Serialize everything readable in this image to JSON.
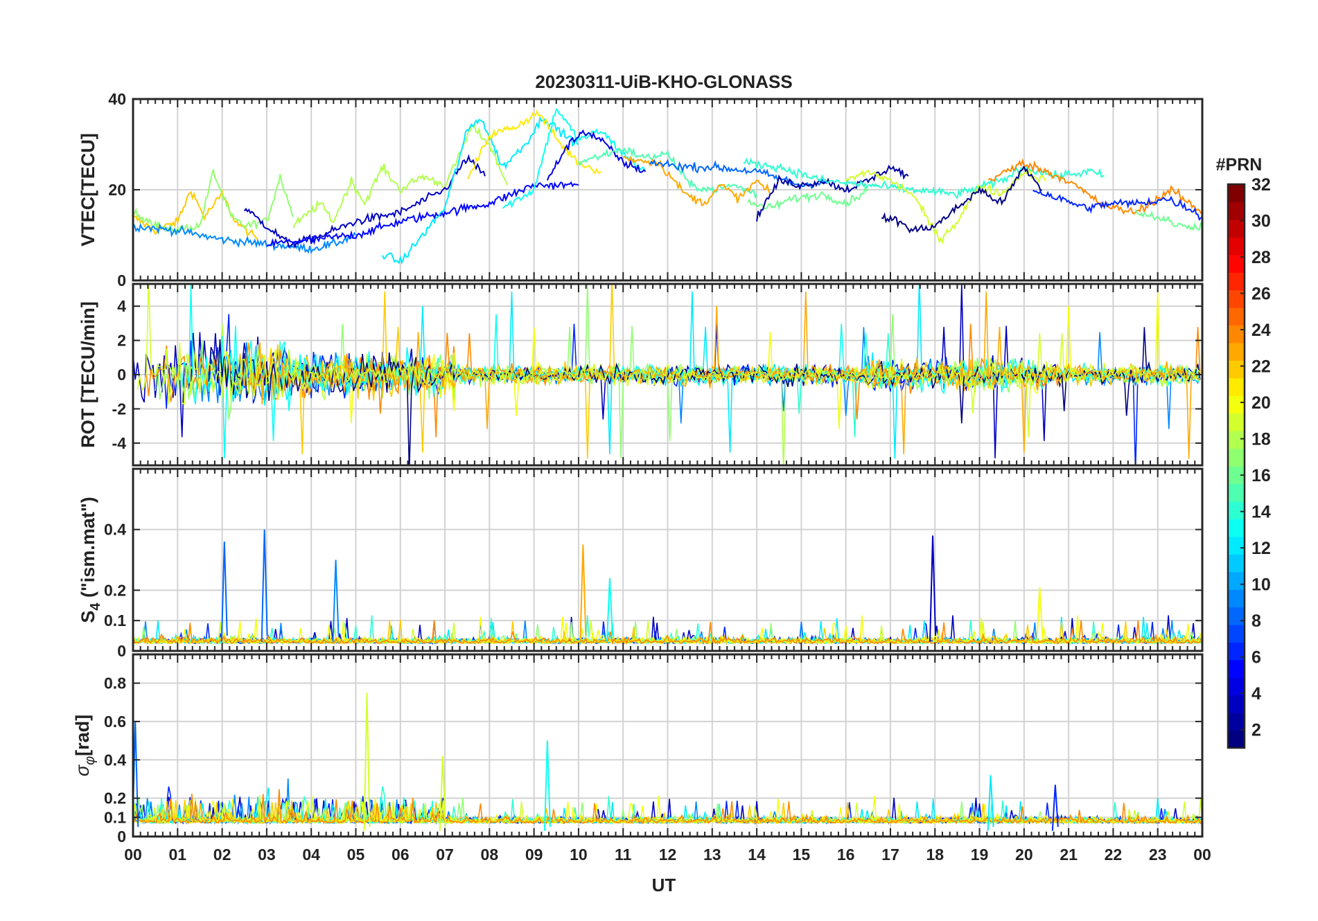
{
  "chart_data": {
    "type": "line",
    "title": "20230311-UiB-KHO-GLONASS",
    "xlabel": "UT",
    "x_unit": "hour (UT)",
    "x_ticks": [
      "00",
      "01",
      "02",
      "03",
      "04",
      "05",
      "06",
      "07",
      "08",
      "09",
      "10",
      "11",
      "12",
      "13",
      "14",
      "15",
      "16",
      "17",
      "18",
      "19",
      "20",
      "21",
      "22",
      "23",
      "00"
    ],
    "grid": true,
    "colorbar": {
      "title": "#PRN",
      "range": [
        1,
        32
      ],
      "ticks": [
        "2",
        "4",
        "6",
        "8",
        "10",
        "12",
        "14",
        "16",
        "18",
        "20",
        "22",
        "24",
        "26",
        "28",
        "30",
        "32"
      ],
      "colormap": "jet",
      "placement": "right"
    },
    "panels": [
      {
        "name": "vtec",
        "ylabel": "VTEC[TECU]",
        "ylim": [
          0,
          40
        ],
        "yticks": [
          "0",
          "20",
          "40"
        ],
        "series": [
          {
            "prn": 22,
            "points": [
              [
                0,
                14
              ],
              [
                0.5,
                11
              ],
              [
                1,
                13
              ],
              [
                1.3,
                20
              ],
              [
                1.6,
                14
              ],
              [
                2,
                19
              ],
              [
                2.3,
                13
              ],
              [
                2.8,
                9
              ]
            ]
          },
          {
            "prn": 17,
            "points": [
              [
                0,
                15
              ],
              [
                0.8,
                11
              ],
              [
                1.5,
                12
              ],
              [
                1.8,
                24
              ],
              [
                2.2,
                14
              ],
              [
                2.5,
                12
              ],
              [
                3,
                13
              ],
              [
                3.3,
                23
              ],
              [
                3.6,
                14
              ]
            ]
          },
          {
            "prn": 9,
            "points": [
              [
                0,
                12
              ],
              [
                1,
                11
              ],
              [
                2,
                9
              ],
              [
                3,
                8
              ],
              [
                4,
                7
              ],
              [
                4.5,
                8
              ],
              [
                5,
                10
              ]
            ]
          },
          {
            "prn": 18,
            "points": [
              [
                3.6,
                12
              ],
              [
                4.2,
                17
              ],
              [
                4.5,
                13
              ],
              [
                4.9,
                22
              ],
              [
                5.2,
                17
              ],
              [
                5.6,
                25
              ],
              [
                6,
                20
              ],
              [
                6.5,
                23
              ],
              [
                7,
                21
              ],
              [
                7.3,
                27
              ],
              [
                7.6,
                34
              ],
              [
                8,
                30
              ],
              [
                8.4,
                21
              ]
            ]
          },
          {
            "prn": 3,
            "points": [
              [
                2.5,
                16
              ],
              [
                3.5,
                8
              ],
              [
                4,
                9
              ],
              [
                5,
                13
              ],
              [
                6,
                15
              ],
              [
                7,
                20
              ],
              [
                7.5,
                27
              ],
              [
                7.9,
                23
              ]
            ]
          },
          {
            "prn": 5,
            "points": [
              [
                3,
                8
              ],
              [
                4,
                9
              ],
              [
                5,
                10
              ],
              [
                6,
                13
              ],
              [
                7,
                15
              ],
              [
                8,
                17
              ],
              [
                9,
                21
              ],
              [
                10,
                21
              ]
            ]
          },
          {
            "prn": 12,
            "points": [
              [
                5.6,
                6
              ],
              [
                6,
                4
              ],
              [
                6.5,
                10
              ],
              [
                7,
                16
              ],
              [
                7.5,
                33
              ],
              [
                7.8,
                36
              ],
              [
                8.3,
                25
              ],
              [
                8.8,
                30
              ],
              [
                9.2,
                36
              ],
              [
                9.7,
                32
              ],
              [
                10,
                30
              ]
            ]
          },
          {
            "prn": 21,
            "points": [
              [
                7.5,
                22
              ],
              [
                8,
                32
              ],
              [
                8.6,
                34
              ],
              [
                9.1,
                37
              ],
              [
                9.6,
                30
              ],
              [
                10,
                26
              ],
              [
                10.5,
                24
              ]
            ]
          },
          {
            "prn": 13,
            "points": [
              [
                8.3,
                16
              ],
              [
                9,
                20
              ],
              [
                9.5,
                38
              ],
              [
                10,
                31
              ],
              [
                10.5,
                33
              ],
              [
                11,
                28
              ],
              [
                11.5,
                24
              ]
            ]
          },
          {
            "prn": 4,
            "points": [
              [
                9.3,
                22
              ],
              [
                9.7,
                29
              ],
              [
                10.1,
                33
              ],
              [
                10.5,
                31
              ],
              [
                11,
                26
              ],
              [
                11.5,
                24
              ]
            ]
          },
          {
            "prn": 15,
            "points": [
              [
                10,
                26
              ],
              [
                11,
                29
              ],
              [
                11.5,
                27
              ],
              [
                12,
                28
              ],
              [
                12.5,
                21
              ],
              [
                13,
                20
              ],
              [
                13.5,
                21
              ],
              [
                14,
                19
              ]
            ]
          },
          {
            "prn": 23,
            "points": [
              [
                11,
                27
              ],
              [
                11.8,
                26
              ],
              [
                12.4,
                19
              ],
              [
                12.8,
                17
              ],
              [
                13.2,
                21
              ],
              [
                13.6,
                18
              ],
              [
                14,
                22
              ],
              [
                14.3,
                19
              ]
            ]
          },
          {
            "prn": 8,
            "points": [
              [
                11.6,
                26
              ],
              [
                12.5,
                25
              ],
              [
                13,
                25
              ],
              [
                14,
                24
              ],
              [
                15,
                21
              ],
              [
                15.6,
                22
              ]
            ]
          },
          {
            "prn": 16,
            "points": [
              [
                13.8,
                17
              ],
              [
                14.3,
                16
              ],
              [
                14.8,
                18
              ],
              [
                15.5,
                19
              ],
              [
                16,
                17
              ],
              [
                16.5,
                20
              ]
            ]
          },
          {
            "prn": 2,
            "points": [
              [
                14,
                14
              ],
              [
                14.5,
                22
              ],
              [
                15,
                21
              ],
              [
                15.5,
                22
              ],
              [
                16,
                20
              ],
              [
                16.5,
                22
              ],
              [
                17,
                25
              ],
              [
                17.4,
                23
              ]
            ]
          },
          {
            "prn": 14,
            "points": [
              [
                13.7,
                26
              ],
              [
                14.5,
                25
              ],
              [
                15.5,
                22
              ],
              [
                16.5,
                21
              ],
              [
                17.5,
                20
              ],
              [
                18.5,
                19
              ],
              [
                19.5,
                22
              ],
              [
                20,
                25
              ],
              [
                20.7,
                23
              ],
              [
                21.5,
                24
              ],
              [
                21.8,
                23
              ]
            ]
          },
          {
            "prn": 19,
            "points": [
              [
                16,
                22
              ],
              [
                16.5,
                24
              ],
              [
                17,
                22
              ],
              [
                17.5,
                19
              ],
              [
                17.8,
                14
              ],
              [
                18.1,
                9
              ],
              [
                18.5,
                13
              ],
              [
                19,
                21
              ],
              [
                19.5,
                19
              ],
              [
                20,
                24
              ],
              [
                20.5,
                22
              ]
            ]
          },
          {
            "prn": 1,
            "points": [
              [
                16.8,
                14
              ],
              [
                17.2,
                13
              ],
              [
                17.5,
                11
              ],
              [
                18,
                12
              ],
              [
                18.5,
                16
              ],
              [
                19,
                20
              ],
              [
                19.5,
                17
              ],
              [
                20,
                25
              ],
              [
                20.4,
                20
              ]
            ]
          },
          {
            "prn": 24,
            "points": [
              [
                19.2,
                22
              ],
              [
                20,
                26
              ],
              [
                20.5,
                24
              ],
              [
                21,
                22
              ],
              [
                21.7,
                17
              ],
              [
                22,
                16
              ],
              [
                22.5,
                15
              ],
              [
                23,
                18
              ],
              [
                23.3,
                20
              ],
              [
                23.7,
                17
              ],
              [
                24,
                15
              ]
            ]
          },
          {
            "prn": 6,
            "points": [
              [
                20.2,
                20
              ],
              [
                20.8,
                18
              ],
              [
                21.4,
                16
              ],
              [
                22,
                17
              ],
              [
                22.6,
                17
              ],
              [
                23.2,
                18
              ],
              [
                23.7,
                16
              ],
              [
                24,
                14
              ]
            ]
          },
          {
            "prn": 16,
            "points": [
              [
                22.5,
                15
              ],
              [
                23,
                14
              ],
              [
                23.5,
                12
              ],
              [
                24,
                12
              ]
            ]
          }
        ]
      },
      {
        "name": "rot",
        "ylabel": "ROT [TECU/min]",
        "ylim": [
          -5.3,
          5.3
        ],
        "yticks": [
          "-4",
          "-2",
          "0",
          "2",
          "4"
        ],
        "style": "noise around 0 per PRN (dense)"
      },
      {
        "name": "s4",
        "ylabel": "S4 (\"ism.mat\")",
        "ylabel_main": "S",
        "ylabel_sub": "4",
        "ylabel_rest": " (\"ism.mat\")",
        "ylim": [
          0,
          0.6
        ],
        "yticks": [
          "0",
          "0.1",
          "0.2",
          "0.4"
        ],
        "spikes": [
          {
            "t": 2.05,
            "v": 0.36,
            "prn": 8
          },
          {
            "t": 2.95,
            "v": 0.4,
            "prn": 8
          },
          {
            "t": 4.55,
            "v": 0.3,
            "prn": 9
          },
          {
            "t": 10.1,
            "v": 0.35,
            "prn": 23
          },
          {
            "t": 10.7,
            "v": 0.24,
            "prn": 13
          },
          {
            "t": 17.95,
            "v": 0.38,
            "prn": 3
          },
          {
            "t": 20.35,
            "v": 0.21,
            "prn": 20
          }
        ]
      },
      {
        "name": "sigma_phi",
        "ylabel": "σφ[rad]",
        "ylabel_main": "σ",
        "ylabel_sub": "φ",
        "ylabel_rest": "[rad]",
        "ylim": [
          0,
          0.95
        ],
        "yticks": [
          "0",
          "0.1",
          "0.2",
          "0.4",
          "0.6",
          "0.8"
        ],
        "spikes": [
          {
            "t": 0.05,
            "v": 0.6,
            "prn": 8
          },
          {
            "t": 5.25,
            "v": 0.75,
            "prn": 19
          },
          {
            "t": 9.3,
            "v": 0.5,
            "prn": 13
          },
          {
            "t": 6.95,
            "v": 0.42,
            "prn": 19
          },
          {
            "t": 19.25,
            "v": 0.32,
            "prn": 12
          },
          {
            "t": 20.7,
            "v": 0.27,
            "prn": 6
          }
        ]
      }
    ]
  }
}
